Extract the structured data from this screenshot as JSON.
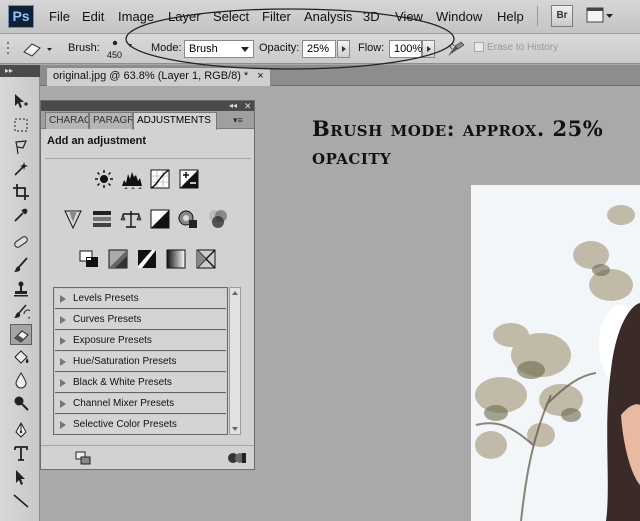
{
  "app": {
    "logo": "Ps"
  },
  "menu": {
    "items": [
      "File",
      "Edit",
      "Image",
      "Layer",
      "Select",
      "Filter",
      "Analysis",
      "3D",
      "View",
      "Window",
      "Help"
    ],
    "bridge_label": "Br"
  },
  "options": {
    "brush_label": "Brush:",
    "brush_size": "450",
    "mode_label": "Mode:",
    "mode_value": "Brush",
    "opacity_label": "Opacity:",
    "opacity_value": "25%",
    "flow_label": "Flow:",
    "flow_value": "100%",
    "erase_history_label": "Erase to History"
  },
  "document": {
    "tab_label": "original.jpg @ 63.8% (Layer 1, RGB/8) *",
    "close_glyph": "×"
  },
  "annotation": {
    "heading": "Brush mode: approx. 25% opacity"
  },
  "adjustments_panel": {
    "collapse_glyph": "◂◂",
    "close_glyph": "✕",
    "tabs": [
      "CHARACTER",
      "PARAGRAPH",
      "ADJUSTMENTS"
    ],
    "active_tab": "ADJUSTMENTS",
    "menu_glyph": "▾≡",
    "title": "Add an adjustment",
    "icons_row1": [
      "brightness-contrast-icon",
      "levels-icon",
      "curves-icon",
      "exposure-icon"
    ],
    "icons_row2": [
      "vibrance-icon",
      "hue-saturation-icon",
      "color-balance-icon",
      "black-white-icon",
      "photo-filter-icon",
      "channel-mixer-icon"
    ],
    "icons_row3": [
      "invert-icon",
      "posterize-icon",
      "threshold-icon",
      "gradient-map-icon",
      "selective-color-icon"
    ],
    "presets": [
      "Levels Presets",
      "Curves Presets",
      "Exposure Presets",
      "Hue/Saturation Presets",
      "Black & White Presets",
      "Channel Mixer Presets",
      "Selective Color Presets"
    ]
  },
  "tools": [
    "move-tool",
    "marquee-tool",
    "lasso-tool",
    "quick-selection-tool",
    "crop-tool",
    "eyedropper-tool",
    "spot-healing-tool",
    "brush-tool",
    "clone-stamp-tool",
    "history-brush-tool",
    "eraser-tool",
    "paint-bucket-tool",
    "blur-tool",
    "dodge-tool",
    "pen-tool",
    "type-tool",
    "path-selection-tool",
    "line-tool"
  ],
  "active_tool": "eraser-tool",
  "colors": {
    "annotation_ellipse": "#222222",
    "ps_logo_bg": "#0f1f36",
    "ps_logo_text": "#8fc4ff"
  }
}
